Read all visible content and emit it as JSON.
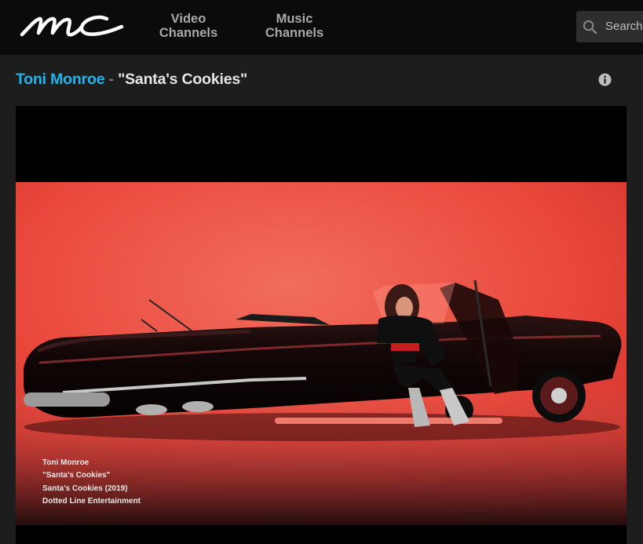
{
  "header": {
    "logo_alt": "mc",
    "nav": [
      {
        "line1": "Video",
        "line2": "Channels"
      },
      {
        "line1": "Music",
        "line2": "Channels"
      }
    ],
    "search_label": "Search"
  },
  "video": {
    "artist": "Toni Monroe",
    "separator": " - ",
    "title": "\"Santa's Cookies\"",
    "credits": [
      "Toni Monroe",
      "\"Santa's Cookies\"",
      "Santa's Cookies (2019)",
      "Dotted Line Entertainment"
    ]
  },
  "colors": {
    "accent": "#1fb6ef",
    "header_bg": "#0b0b0b",
    "page_bg": "#1d1d1d"
  }
}
